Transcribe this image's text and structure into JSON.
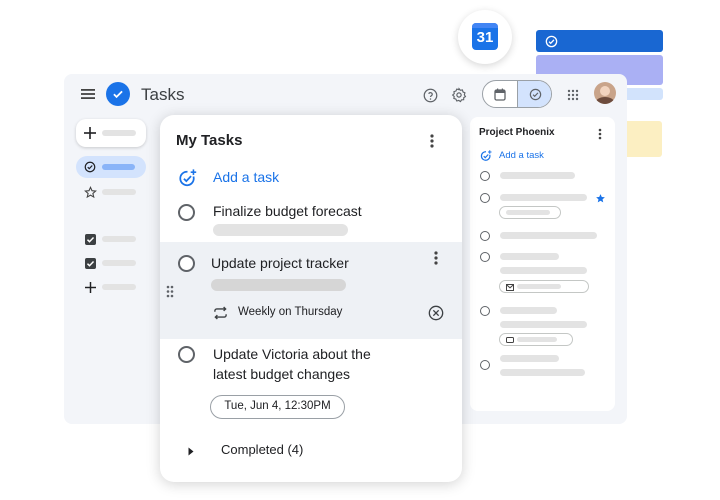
{
  "app": {
    "title": "Tasks",
    "brand_color": "#1a73e8"
  },
  "calendar_badge": {
    "day": "31"
  },
  "main_list": {
    "title": "My Tasks",
    "add_task_label": "Add a task",
    "tasks": [
      {
        "title": "Finalize budget forecast"
      },
      {
        "title": "Update project tracker",
        "repeat": "Weekly on Thursday"
      },
      {
        "title_line1": "Update Victoria about the",
        "title_line2": "latest budget changes",
        "due": "Tue, Jun 4, 12:30PM"
      }
    ],
    "completed_label": "Completed (4)"
  },
  "side_list": {
    "title": "Project Phoenix",
    "add_task_label": "Add a task"
  },
  "icons": {
    "menu": "hamburger-menu-icon",
    "logo": "tasks-logo-icon",
    "help": "help-icon",
    "settings": "gear-icon",
    "calendar_view": "calendar-icon",
    "tasks_view": "tasks-check-icon",
    "apps": "apps-grid-icon",
    "avatar": "user-avatar"
  }
}
